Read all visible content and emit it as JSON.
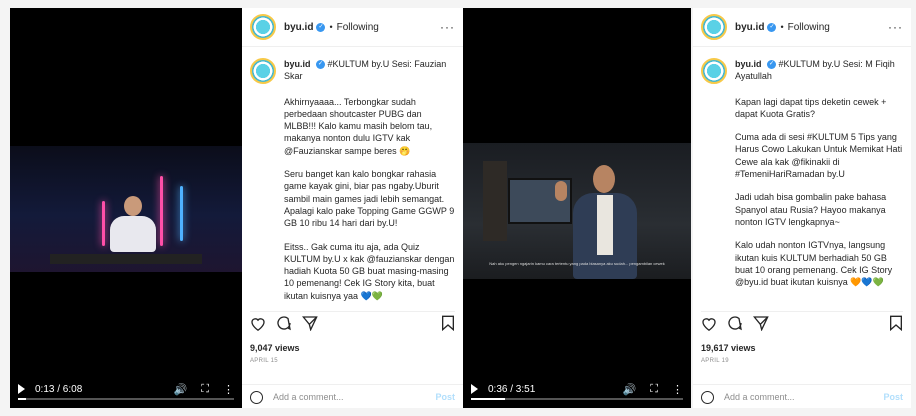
{
  "left": {
    "video": {
      "time": "0:13 / 6:08",
      "progress": 0.035
    },
    "post": {
      "username": "byu.id",
      "follow": "Following",
      "caption_head_user": "byu.id",
      "caption_head_rest": "#KULTUM by.U Sesi: Fauzian Skar",
      "paragraphs": [
        "Akhirnyaaaa... Terbongkar sudah perbedaan shoutcaster PUBG dan MLBB!!! Kalo kamu masih belom tau, makanya nonton dulu IGTV kak @Fauzianskar sampe beres 🤭",
        "Seru banget kan kalo bongkar rahasia game kayak gini, biar pas ngaby.Uburit sambil main games jadi lebih semangat. Apalagi kalo pake Topping Game GGWP 9 GB 10 ribu 14 hari dari by.U!",
        "Eitss.. Gak cuma itu aja, ada Quiz KULTUM by.U x kak @fauzianskar dengan hadiah Kuota 50 GB buat masing-masing 10 pemenang! Cek IG Story kita, buat ikutan kuisnya yaa 💙💚"
      ],
      "views": "9,047 views",
      "date": "APRIL 15",
      "comment_placeholder": "Add a comment...",
      "post_label": "Post"
    }
  },
  "right": {
    "video": {
      "time": "0:36 / 3:51",
      "progress": 0.16,
      "subtitle": "Nah aku pengen ngajarin kamu cara tertentu yang pada biasanya aku sudah... pengambilan cewek"
    },
    "post": {
      "username": "byu.id",
      "follow": "Following",
      "caption_head_user": "byu.id",
      "caption_head_rest": "#KULTUM by.U Sesi: M Fiqih Ayatullah",
      "paragraphs": [
        "Kapan lagi dapat tips deketin cewek + dapat Kuota Gratis?",
        "Cuma ada di sesi #KULTUM 5 Tips yang Harus Cowo Lakukan Untuk Memikat Hati Cewe ala kak @fikinakii di #TemeniHariRamadan by.U",
        "Jadi udah bisa gombalin pake bahasa Spanyol atau Rusia? Hayoo makanya nonton IGTV lengkapnya~",
        "Kalo udah nonton IGTVnya, langsung ikutan kuis KULTUM berhadiah 50 GB buat 10 orang pemenang. Cek IG Story @byu.id buat ikutan kuisnya 🧡💙💚"
      ],
      "views": "19,617 views",
      "date": "APRIL 19",
      "comment_placeholder": "Add a comment...",
      "post_label": "Post"
    }
  },
  "icons": [
    "play-icon",
    "volume-icon",
    "fullscreen-icon",
    "more-vert-icon",
    "heart-icon",
    "comment-icon",
    "share-icon",
    "bookmark-icon",
    "emoji-icon",
    "verified-icon"
  ],
  "colors": {
    "accent": "#3897f0",
    "post_disabled": "#b2dffc",
    "tag": "#00376b"
  }
}
